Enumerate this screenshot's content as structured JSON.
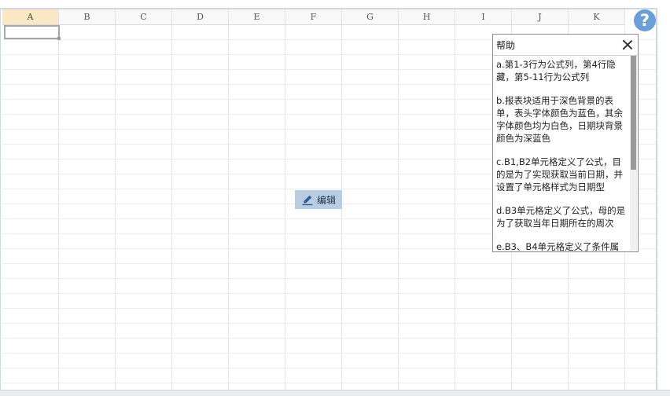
{
  "columns": [
    "A",
    "B",
    "C",
    "D",
    "E",
    "F",
    "G",
    "H",
    "I",
    "J",
    "K"
  ],
  "help_button": {
    "label": "?"
  },
  "edit_button": {
    "label": "编辑"
  },
  "help_panel": {
    "title": "帮助",
    "items": [
      "a.第1-3行为公式列，第4行隐藏，第5-11行为公式列",
      "b.报表块适用于深色背景的表单，表头字体颜色为蓝色，其余字体颜色均为白色，日期块背景颜色为深蓝色",
      "c.B1,B2单元格定义了公式，目的是为了实现获取当前日期，并设置了单元格样式为日期型",
      "d.B3单元格定义了公式，母的是为了获取当年日期所在的周次",
      "e.B3、B4单元格定义了条件属"
    ]
  }
}
